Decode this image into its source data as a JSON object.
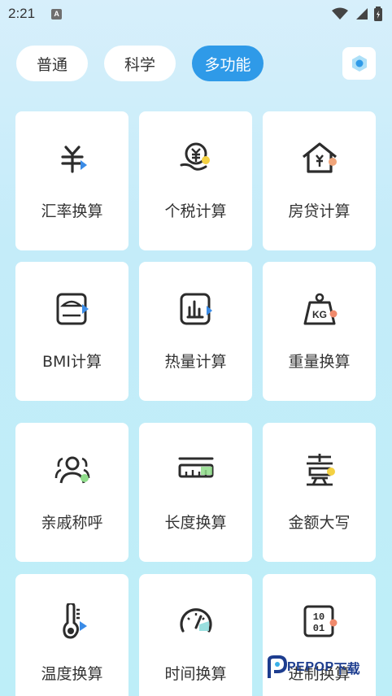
{
  "status_bar": {
    "time": "2:21",
    "badge": "A"
  },
  "tabs": [
    {
      "label": "普通",
      "active": false
    },
    {
      "label": "科学",
      "active": false
    },
    {
      "label": "多功能",
      "active": true
    }
  ],
  "colors": {
    "accent": "#2f9ae8",
    "icon_dark": "#2c2c2c",
    "tab_active_text": "#ffffff"
  },
  "tools": [
    {
      "label": "汇率换算",
      "icon": "currency-exchange-icon"
    },
    {
      "label": "个税计算",
      "icon": "income-tax-icon"
    },
    {
      "label": "房贷计算",
      "icon": "mortgage-icon"
    },
    {
      "label": "BMI计算",
      "icon": "bmi-scale-icon"
    },
    {
      "label": "热量计算",
      "icon": "calorie-chart-icon"
    },
    {
      "label": "重量换算",
      "icon": "weight-kg-icon"
    },
    {
      "label": "亲戚称呼",
      "icon": "relatives-icon"
    },
    {
      "label": "长度换算",
      "icon": "ruler-icon"
    },
    {
      "label": "金额大写",
      "icon": "chinese-numeral-icon"
    },
    {
      "label": "温度换算",
      "icon": "thermometer-icon"
    },
    {
      "label": "时间换算",
      "icon": "speedometer-icon"
    },
    {
      "label": "进制换算",
      "icon": "binary-icon"
    }
  ],
  "watermark": {
    "brand": "PEPOP",
    "suffix": "下载"
  }
}
